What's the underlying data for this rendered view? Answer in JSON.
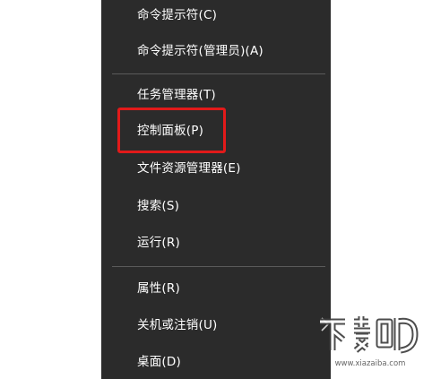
{
  "menu": {
    "items": [
      {
        "label": "命令提示符(C)"
      },
      {
        "label": "命令提示符(管理员)(A)"
      },
      {
        "label": "任务管理器(T)"
      },
      {
        "label": "控制面板(P)"
      },
      {
        "label": "文件资源管理器(E)"
      },
      {
        "label": "搜索(S)"
      },
      {
        "label": "运行(R)"
      },
      {
        "label": "属性(R)"
      },
      {
        "label": "关机或注销(U)"
      },
      {
        "label": "桌面(D)"
      }
    ],
    "highlight_color": "#e21a1a",
    "background_color": "#2b2b2b"
  },
  "watermark": {
    "text": "下载吧",
    "url": "www.xiazaiba.com"
  }
}
